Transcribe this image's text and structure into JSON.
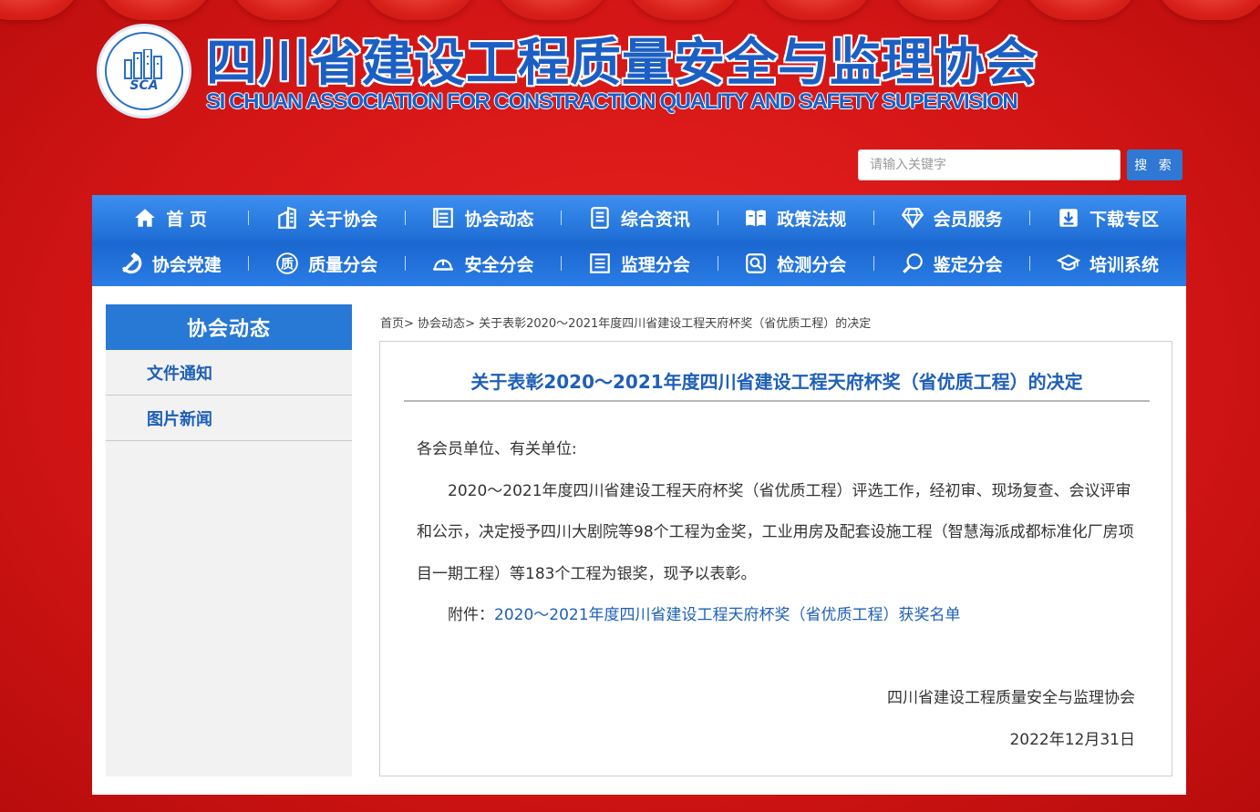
{
  "header": {
    "logo_text": "SCA",
    "title_cn": "四川省建设工程质量安全与监理协会",
    "title_en": "SI CHUAN ASSOCIATION FOR CONSTRACTION QUALITY AND SAFETY SUPERVISION"
  },
  "search": {
    "placeholder": "请输入关键字",
    "button_label": "搜 索"
  },
  "nav": {
    "row1": [
      {
        "label": "首 页",
        "icon": "home-icon"
      },
      {
        "label": "关于协会",
        "icon": "building-icon"
      },
      {
        "label": "协会动态",
        "icon": "list-icon"
      },
      {
        "label": "综合资讯",
        "icon": "document-icon"
      },
      {
        "label": "政策法规",
        "icon": "book-icon"
      },
      {
        "label": "会员服务",
        "icon": "diamond-icon"
      },
      {
        "label": "下载专区",
        "icon": "download-icon"
      }
    ],
    "row2": [
      {
        "label": "协会党建",
        "icon": "hammer-sickle-icon"
      },
      {
        "label": "质量分会",
        "icon": "quality-icon"
      },
      {
        "label": "安全分会",
        "icon": "hardhat-icon"
      },
      {
        "label": "监理分会",
        "icon": "supervision-icon"
      },
      {
        "label": "检测分会",
        "icon": "inspect-icon"
      },
      {
        "label": "鉴定分会",
        "icon": "magnifier-icon"
      },
      {
        "label": "培训系统",
        "icon": "graduation-cap-icon"
      }
    ]
  },
  "sidebar": {
    "title": "协会动态",
    "items": [
      {
        "label": "文件通知"
      },
      {
        "label": "图片新闻"
      }
    ]
  },
  "breadcrumb": {
    "home": "首页",
    "sep1": "> ",
    "section": "协会动态",
    "sep2": "> ",
    "current": "关于表彰2020～2021年度四川省建设工程天府杯奖（省优质工程）的决定"
  },
  "article": {
    "title": "关于表彰2020～2021年度四川省建设工程天府杯奖（省优质工程）的决定",
    "salutation": "各会员单位、有关单位:",
    "body": "2020～2021年度四川省建设工程天府杯奖（省优质工程）评选工作，经初审、现场复查、会议评审和公示，决定授予四川大剧院等98个工程为金奖，工业用房及配套设施工程（智慧海派成都标准化厂房项目一期工程）等183个工程为银奖，现予以表彰。",
    "attachment_prefix": "附件：",
    "attachment_link": "2020～2021年度四川省建设工程天府杯奖（省优质工程）获奖名单",
    "signature_org": "四川省建设工程质量安全与监理协会",
    "signature_date": "2022年12月31日"
  },
  "colors": {
    "background_red": "#d51616",
    "brand_blue": "#1e5fb8",
    "nav_blue": "#1f6fd6",
    "sidebar_head": "#2878d6"
  }
}
